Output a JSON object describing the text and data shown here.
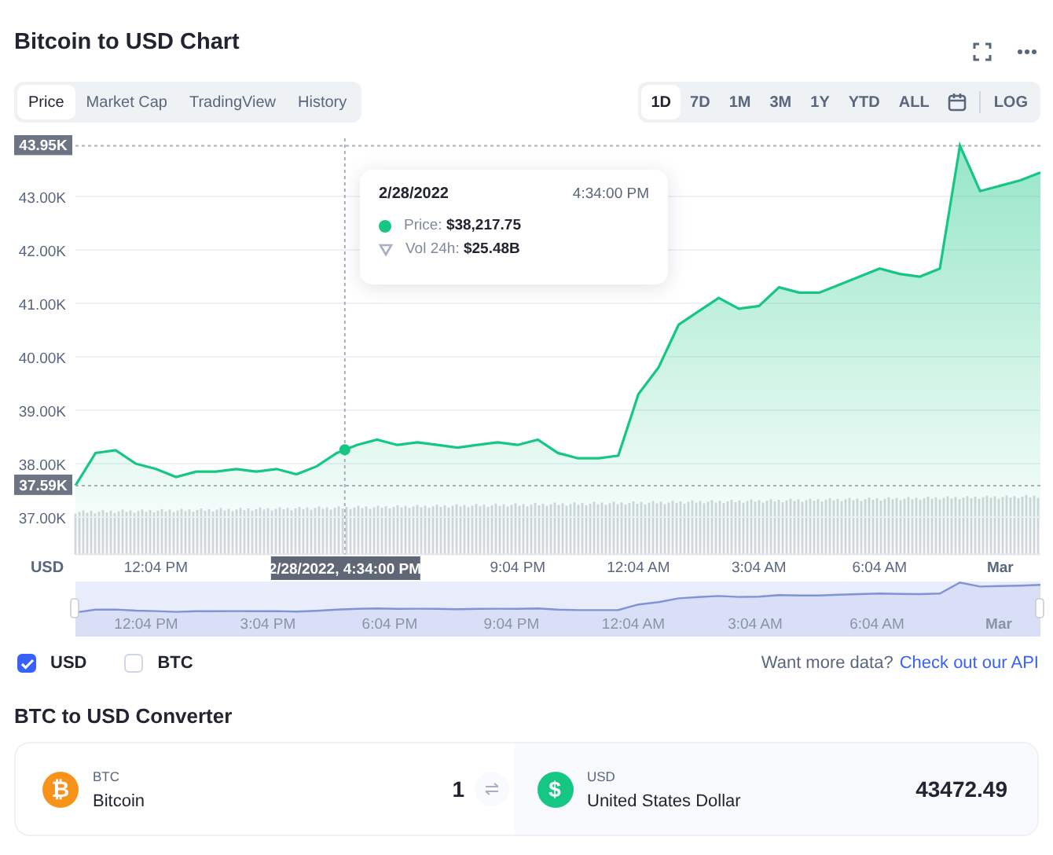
{
  "title": "Bitcoin to USD Chart",
  "view_tabs": [
    {
      "label": "Price",
      "selected": true
    },
    {
      "label": "Market Cap",
      "selected": false
    },
    {
      "label": "TradingView",
      "selected": false
    },
    {
      "label": "History",
      "selected": false
    }
  ],
  "ranges": [
    {
      "label": "1D",
      "selected": true
    },
    {
      "label": "7D",
      "selected": false
    },
    {
      "label": "1M",
      "selected": false
    },
    {
      "label": "3M",
      "selected": false
    },
    {
      "label": "1Y",
      "selected": false
    },
    {
      "label": "YTD",
      "selected": false
    },
    {
      "label": "ALL",
      "selected": false
    }
  ],
  "log_toggle": {
    "label": "LOG",
    "selected": false
  },
  "chart": {
    "axis_unit": "USD",
    "high_label": "43.95K",
    "low_label": "37.59K",
    "tooltip": {
      "date": "2/28/2022",
      "time": "4:34:00 PM",
      "price_label": "Price:",
      "price": "$38,217.75",
      "volume_label": "Vol 24h:",
      "volume": "$25.48B"
    },
    "chart_data": {
      "type": "area",
      "categories": [
        null,
        null,
        null,
        null,
        "12:04 PM",
        null,
        null,
        null,
        null,
        null,
        null,
        null,
        null,
        null,
        null,
        null,
        null,
        null,
        null,
        null,
        null,
        null,
        "9:04 PM",
        null,
        null,
        null,
        null,
        null,
        "12:04 AM",
        null,
        null,
        null,
        null,
        null,
        "3:04 AM",
        null,
        null,
        null,
        null,
        null,
        "6:04 AM",
        null,
        null,
        null,
        null,
        null,
        "Mar",
        null,
        null
      ],
      "series": [
        {
          "color": "#16c784",
          "values": [
            37.59,
            38.2,
            38.25,
            38.0,
            37.9,
            37.75,
            37.85,
            37.85,
            37.9,
            37.85,
            37.9,
            37.8,
            37.95,
            38.2,
            38.35,
            38.45,
            38.35,
            38.4,
            38.35,
            38.3,
            38.35,
            38.4,
            38.35,
            38.45,
            38.2,
            38.1,
            38.1,
            38.15,
            39.3,
            39.8,
            40.6,
            40.85,
            41.1,
            40.9,
            40.95,
            41.3,
            41.2,
            41.2,
            41.35,
            41.5,
            41.65,
            41.55,
            41.5,
            41.65,
            43.95,
            43.1,
            43.2,
            43.3,
            43.45
          ]
        }
      ],
      "ylim": [
        36.3,
        44.1
      ],
      "grid": true,
      "yticks": [
        {
          "value": 37,
          "label": "37.00K"
        },
        {
          "value": 38,
          "label": "38.00K"
        },
        {
          "value": 39,
          "label": "39.00K"
        },
        {
          "value": 40,
          "label": "40.00K"
        },
        {
          "value": 41,
          "label": "41.00K"
        },
        {
          "value": 42,
          "label": "42.00K"
        },
        {
          "value": 43,
          "label": "43.00K"
        }
      ],
      "annotations": [
        "2/28/2022, 4:34:00 PM"
      ]
    }
  },
  "navigator": {
    "labels": [
      "12:04 PM",
      "3:04 PM",
      "6:04 PM",
      "9:04 PM",
      "12:04 AM",
      "3:04 AM",
      "6:04 AM",
      "Mar"
    ]
  },
  "currencies": [
    {
      "label": "USD",
      "checked": true
    },
    {
      "label": "BTC",
      "checked": false
    }
  ],
  "api_prompt": {
    "text": "Want more data?",
    "link": "Check out our API"
  },
  "converter": {
    "title": "BTC to USD Converter",
    "from": {
      "code": "BTC",
      "name": "Bitcoin",
      "amount": "1",
      "symbol": "₿"
    },
    "to": {
      "code": "USD",
      "name": "United States Dollar",
      "amount": "43472.49",
      "symbol": "$"
    }
  }
}
